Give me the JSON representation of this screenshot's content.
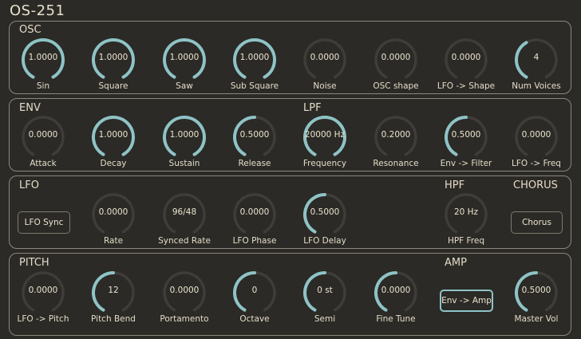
{
  "app_title": "OS-251",
  "accent": "#8fc3c6",
  "track": "#3f3d39",
  "sections": {
    "osc": "OSC",
    "env": "ENV",
    "lpf": "LPF",
    "lfo": "LFO",
    "hpf": "HPF",
    "chorus": "CHORUS",
    "pitch": "PITCH",
    "amp": "AMP"
  },
  "knobs": [
    {
      "id": "sin",
      "value": "1.0000",
      "label": "Sin",
      "level": 1
    },
    {
      "id": "square",
      "value": "1.0000",
      "label": "Square",
      "level": 1
    },
    {
      "id": "saw",
      "value": "1.0000",
      "label": "Saw",
      "level": 1
    },
    {
      "id": "sub-square",
      "value": "1.0000",
      "label": "Sub Square",
      "level": 1
    },
    {
      "id": "noise",
      "value": "0.0000",
      "label": "Noise",
      "level": 0
    },
    {
      "id": "osc-shape",
      "value": "0.0000",
      "label": "OSC shape",
      "level": 0
    },
    {
      "id": "lfo-shape",
      "value": "0.0000",
      "label": "LFO -> Shape",
      "level": 0
    },
    {
      "id": "num-voices",
      "value": "4",
      "label": "Num Voices",
      "level": 0.4
    },
    {
      "id": "attack",
      "value": "0.0000",
      "label": "Attack",
      "level": 0
    },
    {
      "id": "decay",
      "value": "1.0000",
      "label": "Decay",
      "level": 1
    },
    {
      "id": "sustain",
      "value": "1.0000",
      "label": "Sustain",
      "level": 1
    },
    {
      "id": "release",
      "value": "0.5000",
      "label": "Release",
      "level": 0.5
    },
    {
      "id": "frequency",
      "value": "20000 Hz",
      "label": "Frequency",
      "level": 1
    },
    {
      "id": "resonance",
      "value": "0.2000",
      "label": "Resonance",
      "level": 0
    },
    {
      "id": "env-filter",
      "value": "0.5000",
      "label": "Env -> Filter",
      "level": 0.5
    },
    {
      "id": "lfo-freq",
      "value": "0.0000",
      "label": "LFO -> Freq",
      "level": 0
    },
    {
      "id": "rate",
      "value": "0.0000",
      "label": "Rate",
      "level": 0
    },
    {
      "id": "synced-rate",
      "value": "96/48",
      "label": "Synced Rate",
      "level": 0
    },
    {
      "id": "lfo-phase",
      "value": "0.0000",
      "label": "LFO Phase",
      "level": 0
    },
    {
      "id": "lfo-delay",
      "value": "0.5000",
      "label": "LFO Delay",
      "level": 0.5
    },
    {
      "id": "hpf-freq",
      "value": "20 Hz",
      "label": "HPF Freq",
      "level": 0
    },
    {
      "id": "lfo-pitch",
      "value": "0.0000",
      "label": "LFO -> Pitch",
      "level": 0
    },
    {
      "id": "pitch-bend",
      "value": "12",
      "label": "Pitch Bend",
      "level": 0.5
    },
    {
      "id": "portamento",
      "value": "0.0000",
      "label": "Portamento",
      "level": 0
    },
    {
      "id": "octave",
      "value": "0",
      "label": "Octave",
      "level": 0.5
    },
    {
      "id": "semi",
      "value": "0 st",
      "label": "Semi",
      "level": 0.5
    },
    {
      "id": "fine-tune",
      "value": "0.0000",
      "label": "Fine Tune",
      "level": 0.5
    },
    {
      "id": "master-vol",
      "value": "0.5000",
      "label": "Master Vol",
      "level": 0.5
    }
  ],
  "buttons": {
    "lfo_sync": "LFO Sync",
    "chorus": "Chorus",
    "env_amp": "Env -> Amp"
  }
}
